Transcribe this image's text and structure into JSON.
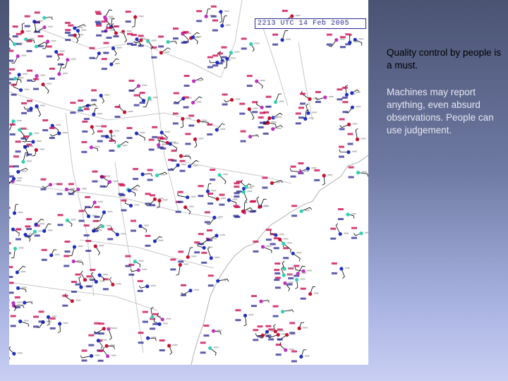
{
  "map": {
    "header": "2213 UTC 14 Feb 2005",
    "colors": {
      "land": "#ffffff",
      "state_lines": "#c8c8c8",
      "coastline": "#bdbdbd",
      "temperature_text": "#c8004a",
      "dewpoint_text": "#1a1a8a",
      "station_blue": "#1f2fc4",
      "station_red": "#c8102e",
      "station_magenta": "#c030c0",
      "station_cyan": "#30d0b0",
      "wind_barb": "#000000"
    },
    "legend_icons": [
      "station-circle-icon",
      "wind-barb-icon"
    ]
  },
  "text": {
    "point1": "Quality control by people is a must.",
    "point2": "Machines may report anything, even absurd observations. People can use judgement."
  }
}
